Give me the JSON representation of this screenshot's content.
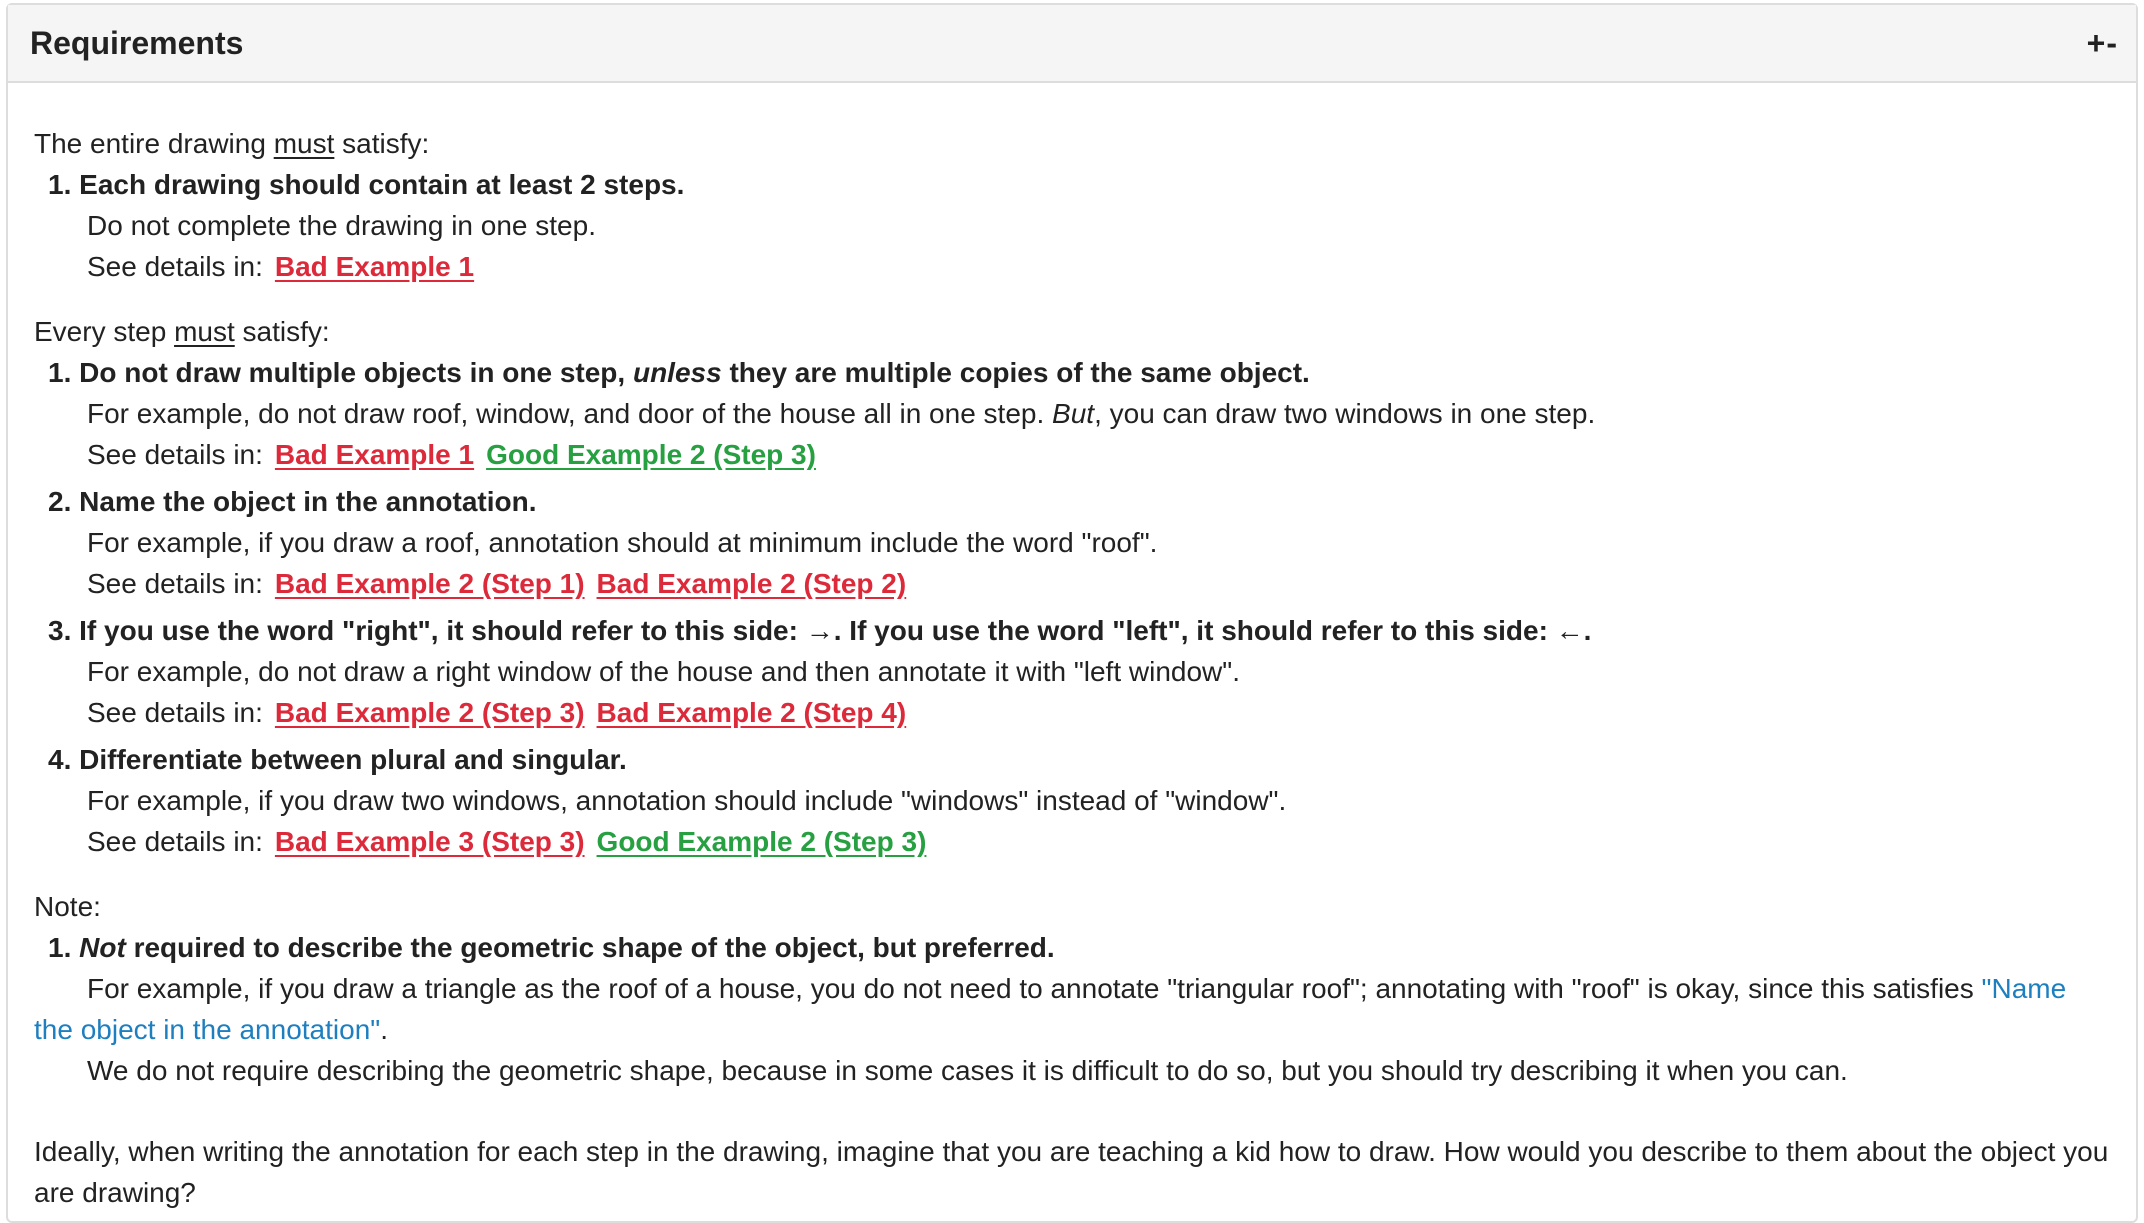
{
  "panel": {
    "title": "Requirements",
    "toggle": "+-"
  },
  "drawing": {
    "prefix": "The entire drawing ",
    "keyword": "must",
    "suffix": " satisfy:",
    "item1": {
      "number": "1.",
      "title": "Each drawing should contain at least 2 steps.",
      "desc": "Do not complete the drawing in one step.",
      "see": "See details in:",
      "links": [
        "Bad Example 1"
      ]
    }
  },
  "step": {
    "prefix": "Every step ",
    "keyword": "must",
    "suffix": " satisfy:",
    "item1": {
      "number": "1.",
      "title_a": "Do not draw multiple objects in one step, ",
      "title_em": "unless",
      "title_b": " they are multiple copies of the same object.",
      "desc_a": "For example, do not draw roof, window, and door of the house all in one step. ",
      "desc_em": "But",
      "desc_b": ", you can draw two windows in one step.",
      "see": "See details in:",
      "link_bad": "Bad Example 1",
      "link_good": "Good Example 2 (Step 3)"
    },
    "item2": {
      "number": "2.",
      "title": "Name the object in the annotation.",
      "desc": "For example, if you draw a roof, annotation should at minimum include the word \"roof\".",
      "see": "See details in:",
      "link_bad1": "Bad Example 2 (Step 1)",
      "link_bad2": "Bad Example 2 (Step 2)"
    },
    "item3": {
      "number": "3.",
      "title": "If you use the word \"right\", it should refer to this side: →. If you use the word \"left\", it should refer to this side: ←.",
      "desc": "For example, do not draw a right window of the house and then annotate it with \"left window\".",
      "see": "See details in:",
      "link_bad1": "Bad Example 2 (Step 3)",
      "link_bad2": "Bad Example 2 (Step 4)"
    },
    "item4": {
      "number": "4.",
      "title": "Differentiate between plural and singular.",
      "desc": "For example, if you draw two windows, annotation should include \"windows\" instead of \"window\".",
      "see": "See details in:",
      "link_bad": "Bad Example 3 (Step 3)",
      "link_good": "Good Example 2 (Step 3)"
    }
  },
  "note": {
    "label": "Note:",
    "item1": {
      "number": "1.",
      "title_em": "Not",
      "title_b": " required to describe the geometric shape of the object, but preferred.",
      "desc_a": "For example, if you draw a triangle as the roof of a house, you do not need to annotate \"triangular roof\"; annotating with \"roof\" is okay, since this satisfies ",
      "desc_link": "\"Name the object in the annotation\"",
      "desc_b": ".",
      "desc2": "We do not require describing the geometric shape, because in some cases it is difficult to do so, but you should try describing it when you can."
    }
  },
  "closing": "Ideally, when writing the annotation for each step in the drawing, imagine that you are teaching a kid how to draw. How would you describe to them about the object you are drawing?"
}
